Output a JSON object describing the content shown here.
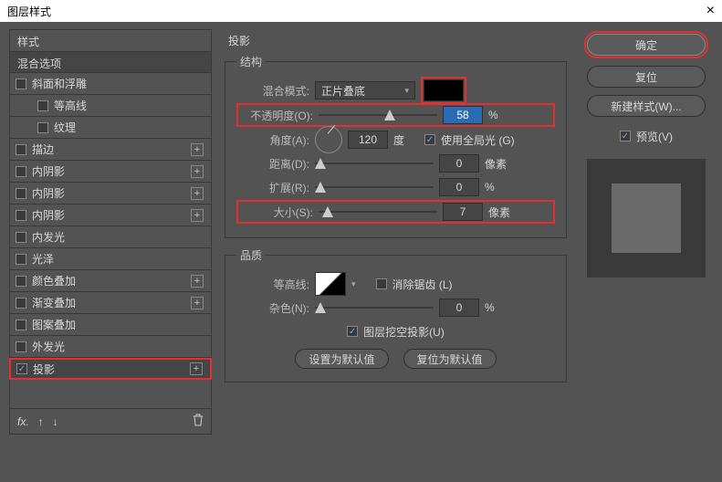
{
  "title": "图层样式",
  "left": {
    "styles": "样式",
    "blend": "混合选项",
    "items": [
      {
        "label": "斜面和浮雕",
        "chk": false,
        "plus": false,
        "sub": false
      },
      {
        "label": "等高线",
        "chk": false,
        "plus": false,
        "sub": true
      },
      {
        "label": "纹理",
        "chk": false,
        "plus": false,
        "sub": true
      },
      {
        "label": "描边",
        "chk": false,
        "plus": true,
        "sub": false
      },
      {
        "label": "内阴影",
        "chk": false,
        "plus": true,
        "sub": false
      },
      {
        "label": "内阴影",
        "chk": false,
        "plus": true,
        "sub": false
      },
      {
        "label": "内阴影",
        "chk": false,
        "plus": true,
        "sub": false
      },
      {
        "label": "内发光",
        "chk": false,
        "plus": false,
        "sub": false
      },
      {
        "label": "光泽",
        "chk": false,
        "plus": false,
        "sub": false
      },
      {
        "label": "颜色叠加",
        "chk": false,
        "plus": true,
        "sub": false
      },
      {
        "label": "渐变叠加",
        "chk": false,
        "plus": true,
        "sub": false
      },
      {
        "label": "图案叠加",
        "chk": false,
        "plus": false,
        "sub": false
      },
      {
        "label": "外发光",
        "chk": false,
        "plus": false,
        "sub": false
      },
      {
        "label": "投影",
        "chk": true,
        "plus": true,
        "sub": false,
        "sel": true,
        "hl": true
      }
    ]
  },
  "mid": {
    "title": "投影",
    "structure": "结构",
    "blendmode_lbl": "混合模式:",
    "blendmode_val": "正片叠底",
    "opacity_lbl": "不透明度(O):",
    "opacity_val": "58",
    "opacity_unit": "%",
    "angle_lbl": "角度(A):",
    "angle_val": "120",
    "angle_unit": "度",
    "global_lbl": "使用全局光 (G)",
    "distance_lbl": "距离(D):",
    "distance_val": "0",
    "distance_unit": "像素",
    "spread_lbl": "扩展(R):",
    "spread_val": "0",
    "spread_unit": "%",
    "size_lbl": "大小(S):",
    "size_val": "7",
    "size_unit": "像素",
    "quality": "品质",
    "contour_lbl": "等高线:",
    "antialias_lbl": "消除锯齿 (L)",
    "noise_lbl": "杂色(N):",
    "noise_val": "0",
    "noise_unit": "%",
    "knockout_lbl": "图层挖空投影(U)",
    "btn_default": "设置为默认值",
    "btn_reset": "复位为默认值"
  },
  "right": {
    "ok": "确定",
    "cancel": "复位",
    "newstyle": "新建样式(W)...",
    "preview": "预览(V)"
  }
}
